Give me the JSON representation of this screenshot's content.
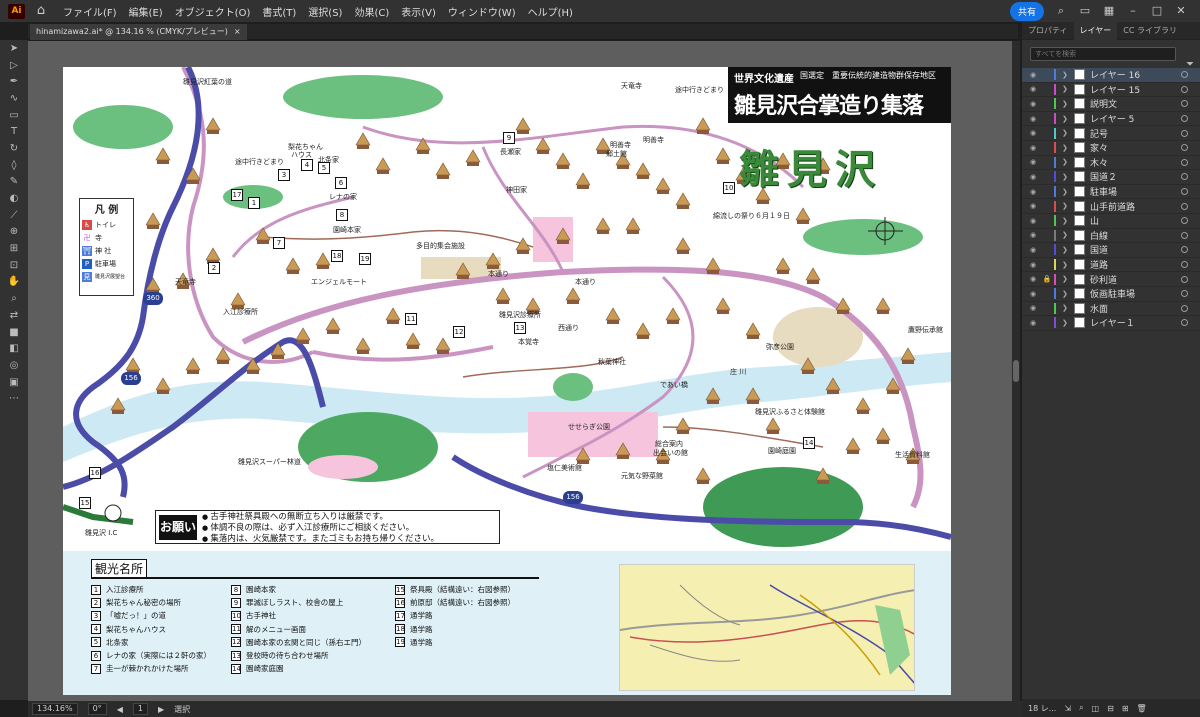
{
  "app": {
    "logo": "Ai",
    "menus": [
      "ファイル(F)",
      "編集(E)",
      "オブジェクト(O)",
      "書式(T)",
      "選択(S)",
      "効果(C)",
      "表示(V)",
      "ウィンドウ(W)",
      "ヘルプ(H)"
    ],
    "share": "共有"
  },
  "doc_tab": {
    "title": "hinamizawa2.ai* @ 134.16 % (CMYK/プレビュー)",
    "close": "×"
  },
  "map": {
    "title_small": "世界文化遺産",
    "title_small2": "国選定　重要伝統的建造物群保存地区",
    "title_big": "雛見沢合掌造り集落",
    "big_name": "雛見沢",
    "legend_title": "凡 例",
    "legend": [
      {
        "icon": "toilet-icon",
        "label": "トイレ"
      },
      {
        "icon": "temple-icon",
        "label": "寺"
      },
      {
        "icon": "shrine-icon",
        "label": "神 社"
      },
      {
        "icon": "parking-icon",
        "label": "駐車場"
      },
      {
        "icon": "viewpoint-icon",
        "label": "雛見沢展望台"
      }
    ],
    "notice_label": "お願い",
    "notices": [
      "古手神社祭具殿への無断立ち入りは厳禁です。",
      "体調不良の際は、必ず入江診療所にご相談ください。",
      "集落内は、火気厳禁です。またゴミもお持ち帰りください。"
    ],
    "labels": [
      {
        "id": "l1",
        "text": "雛見沢紅葉の道"
      },
      {
        "id": "l2",
        "text": "天竜寺"
      },
      {
        "id": "l3",
        "text": "途中行きどまり"
      },
      {
        "id": "l4",
        "text": "途中行きどまり"
      },
      {
        "id": "l5",
        "text": "梨花ちゃん"
      },
      {
        "id": "l6",
        "text": "ハウス"
      },
      {
        "id": "l7",
        "text": "北条家"
      },
      {
        "id": "l8",
        "text": "レナの家"
      },
      {
        "id": "l9",
        "text": "長瀬家"
      },
      {
        "id": "l10",
        "text": "明善寺"
      },
      {
        "id": "l11",
        "text": "郷土館"
      },
      {
        "id": "l12",
        "text": "明善寺"
      },
      {
        "id": "l13",
        "text": "神田家"
      },
      {
        "id": "l14",
        "text": "綿流しの祭り６月１９日"
      },
      {
        "id": "l15",
        "text": "園崎本家"
      },
      {
        "id": "l16",
        "text": "多目的集会施設"
      },
      {
        "id": "l17",
        "text": "本通り"
      },
      {
        "id": "l18",
        "text": "雛見沢診療所"
      },
      {
        "id": "l19",
        "text": "本覚寺"
      },
      {
        "id": "l20",
        "text": "西通り"
      },
      {
        "id": "l21",
        "text": "秋葉神社"
      },
      {
        "id": "l22",
        "text": "弥彦公園"
      },
      {
        "id": "l23",
        "text": "庄 川"
      },
      {
        "id": "l24",
        "text": "であい橋"
      },
      {
        "id": "l25",
        "text": "せせらぎ公園"
      },
      {
        "id": "l26",
        "text": "総合案内"
      },
      {
        "id": "l27",
        "text": "出会いの館"
      },
      {
        "id": "l28",
        "text": "塩仁美術館"
      },
      {
        "id": "l29",
        "text": "元気な野菜館"
      },
      {
        "id": "l30",
        "text": "雛見沢ふるさと体験館"
      },
      {
        "id": "l31",
        "text": "園崎庭園"
      },
      {
        "id": "l32",
        "text": "生活資料館"
      },
      {
        "id": "l33",
        "text": "雛見沢スーパー林道"
      },
      {
        "id": "l34",
        "text": "雛見沢 I.C"
      },
      {
        "id": "l35",
        "text": "入江診療所"
      },
      {
        "id": "l36",
        "text": "エンジェルモート"
      },
      {
        "id": "l37",
        "text": "天竜寺"
      },
      {
        "id": "l38",
        "text": "鷹野伝承館"
      },
      {
        "id": "l39",
        "text": "本通り"
      }
    ],
    "route_shields": [
      "360",
      "156",
      "156"
    ],
    "numbers": [
      "1",
      "2",
      "3",
      "4",
      "5",
      "6",
      "7",
      "8",
      "9",
      "10",
      "11",
      "12",
      "13",
      "14",
      "15",
      "16",
      "17",
      "18",
      "19"
    ],
    "kanko_title": "観光名所",
    "spots": [
      {
        "n": "1",
        "t": "入江診療所"
      },
      {
        "n": "2",
        "t": "梨花ちゃん秘密の場所"
      },
      {
        "n": "3",
        "t": "「嘘だっ！」の道"
      },
      {
        "n": "4",
        "t": "梨花ちゃんハウス"
      },
      {
        "n": "5",
        "t": "北条家"
      },
      {
        "n": "6",
        "t": "レナの家（実際には２軒の家）"
      },
      {
        "n": "7",
        "t": "圭一が棘かれかけた場所"
      },
      {
        "n": "8",
        "t": "園崎本家"
      },
      {
        "n": "9",
        "t": "罪滅ぼしラスト、校舎の屋上"
      },
      {
        "n": "10",
        "t": "古手神社"
      },
      {
        "n": "11",
        "t": "解のメニュー画面"
      },
      {
        "n": "12",
        "t": "園崎本家の玄関と同じ（孫右エ門）"
      },
      {
        "n": "13",
        "t": "登校時の待ち合わせ場所"
      },
      {
        "n": "14",
        "t": "園崎家庭園"
      },
      {
        "n": "15",
        "t": "祭具殿（結構遠い：右図参照）"
      },
      {
        "n": "16",
        "t": "前原邸（結構遠い：右図参照）"
      },
      {
        "n": "17",
        "t": "通学路"
      },
      {
        "n": "18",
        "t": "通学路"
      },
      {
        "n": "19",
        "t": "通学路"
      }
    ]
  },
  "panel": {
    "tabs": [
      "プロパティ",
      "レイヤー",
      "CC ライブラリ"
    ],
    "search_placeholder": "すべてを検索",
    "layers": [
      {
        "name": "レイヤー 16",
        "color": "#4f7bd9",
        "selected": true,
        "locked": false
      },
      {
        "name": "レイヤー 15",
        "color": "#c84fc8",
        "selected": false,
        "locked": false
      },
      {
        "name": "説明文",
        "color": "#4fc84f",
        "selected": false,
        "locked": false
      },
      {
        "name": "レイヤー 5",
        "color": "#c84fc8",
        "selected": false,
        "locked": false
      },
      {
        "name": "記号",
        "color": "#4fc8c8",
        "selected": false,
        "locked": false
      },
      {
        "name": "家々",
        "color": "#d94f4f",
        "selected": false,
        "locked": false
      },
      {
        "name": "木々",
        "color": "#4f7bd9",
        "selected": false,
        "locked": false
      },
      {
        "name": "国道２",
        "color": "#4f4fd9",
        "selected": false,
        "locked": false
      },
      {
        "name": "駐車場",
        "color": "#4f7bd9",
        "selected": false,
        "locked": false
      },
      {
        "name": "山手前道路",
        "color": "#d94f4f",
        "selected": false,
        "locked": false
      },
      {
        "name": "山",
        "color": "#4fc84f",
        "selected": false,
        "locked": false
      },
      {
        "name": "白線",
        "color": "#7b7b7b",
        "selected": false,
        "locked": false
      },
      {
        "name": "国道",
        "color": "#4f4fd9",
        "selected": false,
        "locked": false
      },
      {
        "name": "道路",
        "color": "#d9d94f",
        "selected": false,
        "locked": false
      },
      {
        "name": "砂利道",
        "color": "#d94fb0",
        "selected": false,
        "locked": true
      },
      {
        "name": "仮画駐車場",
        "color": "#4f7bd9",
        "selected": false,
        "locked": false
      },
      {
        "name": "水面",
        "color": "#4fc84f",
        "selected": false,
        "locked": false
      },
      {
        "name": "レイヤー１",
        "color": "#7b4fd9",
        "selected": false,
        "locked": false
      }
    ],
    "footer": "18 レ..."
  },
  "status": {
    "zoom": "134.16%",
    "rotate": "0°",
    "page": "1",
    "tool": "選択"
  }
}
